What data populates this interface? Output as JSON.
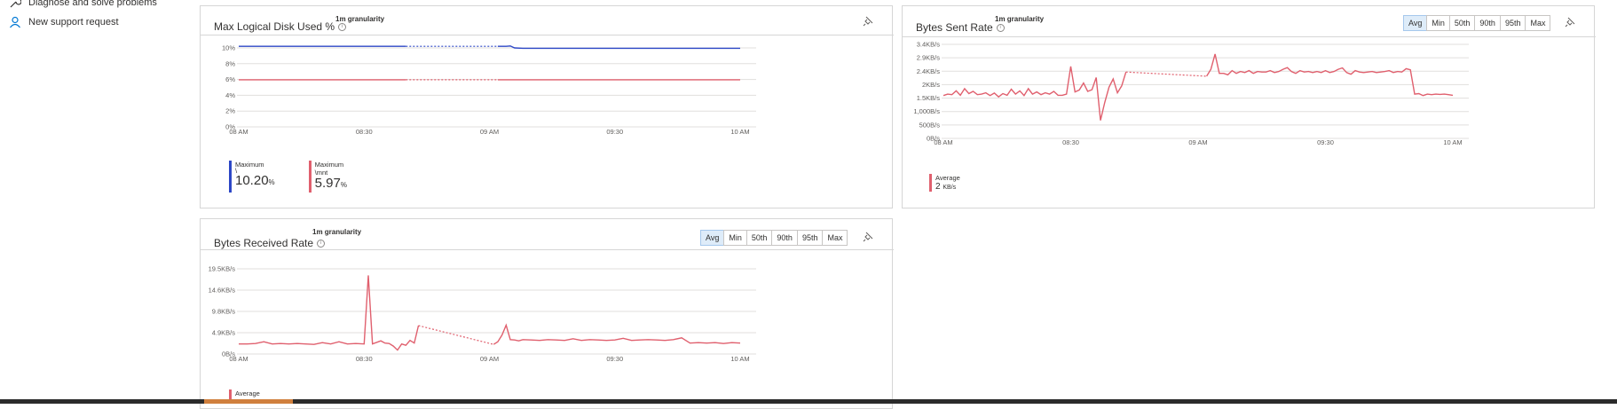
{
  "nav": {
    "diagnose": "Diagnose and solve problems",
    "support": "New support request"
  },
  "colors": {
    "blue": "#2d47c6",
    "red": "#e0606e",
    "grid": "#e1dfdd",
    "accent_active": "#deecf9"
  },
  "aggregations": [
    "Avg",
    "Min",
    "50th",
    "90th",
    "95th",
    "Max"
  ],
  "card1": {
    "title": "Max Logical Disk Used %",
    "granularity": "1m granularity",
    "legend": [
      {
        "label": "Maximum",
        "sub": "\\",
        "value": "10.20",
        "unit": "%"
      },
      {
        "label": "Maximum",
        "sub": "\\mnt",
        "value": "5.97",
        "unit": "%"
      }
    ]
  },
  "card2": {
    "title": "Bytes Sent Rate",
    "granularity": "1m granularity",
    "legend": [
      {
        "label": "Average",
        "value": "2",
        "unit": "KB/s"
      }
    ]
  },
  "card3": {
    "title": "Bytes Received Rate",
    "granularity": "1m granularity",
    "legend": [
      {
        "label": "Average",
        "value": "",
        "unit": ""
      }
    ]
  },
  "chart_data": [
    {
      "type": "line",
      "title": "Max Logical Disk Used %",
      "x_ticks": [
        "08 AM",
        "08:30",
        "09 AM",
        "09:30",
        "10 AM"
      ],
      "y_ticks": [
        "0%",
        "2%",
        "4%",
        "6%",
        "8%",
        "10%"
      ],
      "ylim": [
        0,
        10.5
      ],
      "gap": [
        40,
        62
      ],
      "series": [
        {
          "name": "Maximum \\",
          "color": "#2d47c6",
          "x": [
            0,
            10,
            20,
            30,
            40,
            42,
            44,
            45,
            46,
            47,
            48,
            50,
            55,
            60,
            62,
            64,
            65,
            66,
            68,
            70,
            80,
            90,
            100,
            110,
            120
          ],
          "y": [
            10.2,
            10.2,
            10.2,
            10.2,
            10.2,
            10.2,
            10.25,
            10.3,
            10.25,
            10.2,
            10.2,
            10.2,
            10.2,
            10.2,
            10.2,
            10.2,
            10.25,
            10.0,
            9.95,
            9.95,
            9.95,
            9.95,
            9.95,
            9.95,
            9.95
          ]
        },
        {
          "name": "Maximum \\mnt",
          "color": "#e0606e",
          "x": [
            0,
            40,
            62,
            120
          ],
          "y": [
            5.97,
            5.97,
            5.97,
            5.97
          ]
        }
      ],
      "grid": true
    },
    {
      "type": "line",
      "title": "Bytes Sent Rate",
      "x_ticks": [
        "08 AM",
        "08:30",
        "09 AM",
        "09:30",
        "10 AM"
      ],
      "y_ticks": [
        "0B/s",
        "500B/s",
        "1,000B/s",
        "1.5KB/s",
        "2KB/s",
        "2.4KB/s",
        "2.9KB/s",
        "3.4KB/s"
      ],
      "ylim": [
        0,
        3500
      ],
      "gap": [
        43,
        62
      ],
      "series": [
        {
          "name": "Average",
          "color": "#e0606e",
          "x": [
            0,
            1,
            2,
            3,
            4,
            5,
            6,
            7,
            8,
            9,
            10,
            11,
            12,
            13,
            14,
            15,
            16,
            17,
            18,
            19,
            20,
            21,
            22,
            23,
            24,
            25,
            26,
            27,
            28,
            29,
            30,
            31,
            32,
            33,
            34,
            35,
            36,
            37,
            38,
            39,
            40,
            41,
            42,
            43,
            62,
            63,
            64,
            65,
            66,
            67,
            68,
            69,
            70,
            71,
            72,
            73,
            74,
            75,
            76,
            77,
            78,
            79,
            80,
            81,
            82,
            83,
            84,
            85,
            86,
            87,
            88,
            89,
            90,
            91,
            92,
            93,
            94,
            95,
            96,
            97,
            98,
            99,
            100,
            101,
            102,
            103,
            104,
            105,
            106,
            107,
            108,
            109,
            110,
            111,
            112,
            113,
            114,
            115,
            116,
            117,
            118,
            119,
            120
          ],
          "y": [
            1550,
            1600,
            1580,
            1720,
            1560,
            1800,
            1620,
            1700,
            1580,
            1600,
            1650,
            1550,
            1640,
            1500,
            1620,
            1560,
            1780,
            1600,
            1720,
            1550,
            1800,
            1600,
            1680,
            1580,
            1650,
            1600,
            1700,
            1560,
            1560,
            1600,
            2600,
            1680,
            1750,
            2000,
            1700,
            1760,
            2200,
            650,
            1300,
            1850,
            2150,
            1650,
            1900,
            2400,
            2250,
            2500,
            3050,
            2350,
            2350,
            2300,
            2450,
            2350,
            2420,
            2380,
            2450,
            2350,
            2420,
            2400,
            2400,
            2450,
            2380,
            2420,
            2500,
            2560,
            2420,
            2350,
            2450,
            2400,
            2420,
            2380,
            2420,
            2380,
            2450,
            2380,
            2420,
            2500,
            2550,
            2380,
            2320,
            2450,
            2400,
            2380,
            2400,
            2420,
            2380,
            2400,
            2420,
            2450,
            2380,
            2420,
            2400,
            2520,
            2480,
            1600,
            1620,
            1550,
            1600,
            1580,
            1600,
            1590,
            1600,
            1580,
            1560
          ]
        }
      ],
      "grid": true
    },
    {
      "type": "line",
      "title": "Bytes Received Rate",
      "x_ticks": [
        "08 AM",
        "08:30",
        "09 AM",
        "09:30",
        "10 AM"
      ],
      "y_ticks": [
        "0B/s",
        "4.9KB/s",
        "9.8KB/s",
        "14.6KB/s",
        "19.5KB/s"
      ],
      "ylim": [
        0,
        19500
      ],
      "gap": [
        43,
        61
      ],
      "series": [
        {
          "name": "Average",
          "color": "#e0606e",
          "x": [
            0,
            2,
            4,
            6,
            8,
            10,
            12,
            14,
            16,
            18,
            20,
            22,
            24,
            26,
            28,
            30,
            31,
            32,
            34,
            35,
            36,
            37,
            38,
            39,
            40,
            41,
            42,
            43,
            61,
            62,
            63,
            64,
            65,
            66,
            67,
            68,
            70,
            72,
            74,
            76,
            78,
            80,
            82,
            84,
            86,
            88,
            90,
            92,
            94,
            96,
            98,
            100,
            102,
            104,
            106,
            108,
            110,
            112,
            114,
            116,
            118,
            120
          ],
          "y": [
            2300,
            2300,
            2400,
            2800,
            2300,
            2400,
            2300,
            2400,
            2300,
            2200,
            2600,
            2300,
            2800,
            2300,
            2400,
            2300,
            18000,
            2300,
            3000,
            2500,
            2400,
            1800,
            900,
            2300,
            2000,
            3100,
            2500,
            6500,
            2200,
            2800,
            4300,
            6600,
            3300,
            3200,
            3000,
            3300,
            3200,
            3100,
            3300,
            3200,
            3100,
            3500,
            3100,
            3300,
            3200,
            3100,
            3200,
            3600,
            3100,
            3200,
            3300,
            3200,
            3100,
            3300,
            3700,
            2500,
            2600,
            2500,
            2600,
            2400,
            2600,
            2500
          ]
        }
      ],
      "grid": true
    }
  ]
}
